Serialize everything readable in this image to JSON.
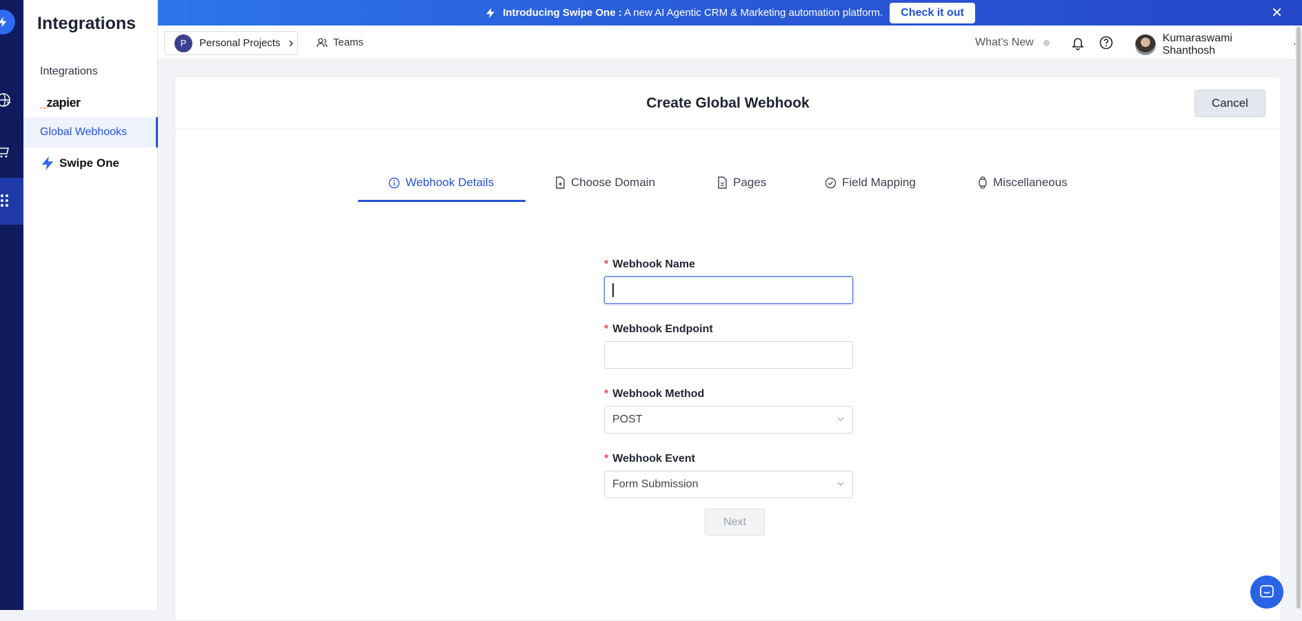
{
  "banner": {
    "prefix": "Introducing Swipe One :",
    "message": "A new AI Agentic CRM & Marketing automation platform.",
    "cta": "Check it out",
    "close_glyph": "✕"
  },
  "sidebar": {
    "title": "Integrations",
    "items": [
      {
        "label": "Integrations"
      },
      {
        "label": "zapier"
      },
      {
        "label": "Global Webhooks"
      },
      {
        "label": "Swipe One"
      }
    ]
  },
  "topbar": {
    "project_initial": "P",
    "project_label": "Personal Projects",
    "teams_label": "Teams",
    "whats_new": "What's New",
    "user_name": "Kumaraswami Shanthosh"
  },
  "page": {
    "title": "Create Global Webhook",
    "cancel_label": "Cancel"
  },
  "tabs": [
    {
      "label": "Webhook Details",
      "icon": "info-circle-icon"
    },
    {
      "label": "Choose Domain",
      "icon": "document-icon"
    },
    {
      "label": "Pages",
      "icon": "page-icon"
    },
    {
      "label": "Field Mapping",
      "icon": "check-circle-icon"
    },
    {
      "label": "Miscellaneous",
      "icon": "watch-icon"
    }
  ],
  "form": {
    "name_label": "Webhook Name",
    "name_value": "",
    "endpoint_label": "Webhook Endpoint",
    "endpoint_value": "",
    "method_label": "Webhook Method",
    "method_value": "POST",
    "event_label": "Webhook Event",
    "event_value": "Form Submission",
    "required_mark": "*",
    "next_label": "Next"
  },
  "colors": {
    "accent": "#2552d8",
    "rail": "#0f1b5c",
    "banner": "#2a5ad8",
    "required": "#e5484d"
  }
}
